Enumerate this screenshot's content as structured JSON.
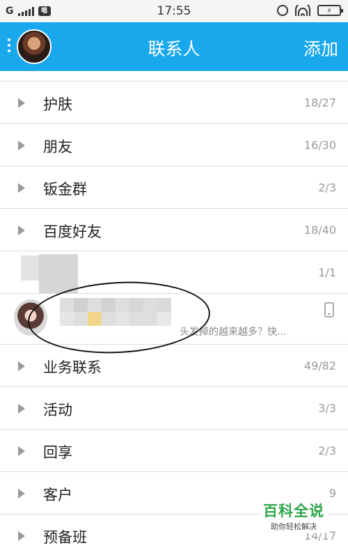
{
  "status_bar": {
    "carrier": "G",
    "msg_icon": "唱",
    "time": "17:55",
    "icons": [
      "signal-icon",
      "message-icon",
      "alarm-icon",
      "wifi-icon",
      "battery-charging-icon"
    ]
  },
  "header": {
    "title": "联系人",
    "add_label": "添加",
    "accent_color": "#19a8ec"
  },
  "groups_top": [
    {
      "name": "护肤",
      "count": "18/27"
    },
    {
      "name": "朋友",
      "count": "16/30"
    },
    {
      "name": "钣金群",
      "count": "2/3"
    },
    {
      "name": "百度好友",
      "count": "18/40"
    }
  ],
  "blurred_group": {
    "count": "1/1"
  },
  "friend": {
    "message": "头发掉的越来越多？快...",
    "device_icon": "phone-icon"
  },
  "groups_bottom": [
    {
      "name": "业务联系",
      "count": "49/82"
    },
    {
      "name": "活动",
      "count": "3/3"
    },
    {
      "name": "回享",
      "count": "2/3"
    },
    {
      "name": "客户",
      "count": "9"
    },
    {
      "name": "预备班",
      "count": "14/17"
    }
  ],
  "watermark": {
    "title": "百科全说",
    "subtitle": "助你轻松解决"
  }
}
